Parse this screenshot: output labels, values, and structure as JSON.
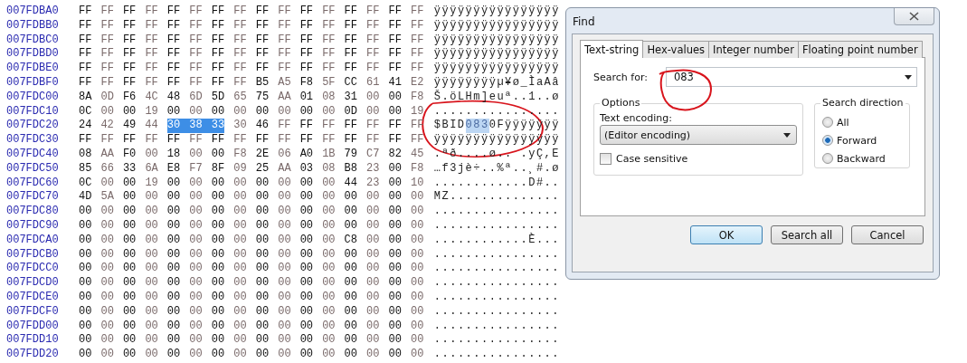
{
  "hex_view": {
    "rows": [
      {
        "address": "007FDBA0",
        "byte_segments": [
          {
            "bytes": "FF FF FF FF FF FF FF FF FF FF FF FF FF FF FF FF",
            "selected": false
          }
        ],
        "text_segments": [
          {
            "text": "ÿÿÿÿÿÿÿÿÿÿÿÿÿÿÿÿ",
            "selected": false
          }
        ]
      },
      {
        "address": "007FDBB0",
        "byte_segments": [
          {
            "bytes": "FF FF FF FF FF FF FF FF FF FF FF FF FF FF FF FF",
            "selected": false
          }
        ],
        "text_segments": [
          {
            "text": "ÿÿÿÿÿÿÿÿÿÿÿÿÿÿÿÿ",
            "selected": false
          }
        ]
      },
      {
        "address": "007FDBC0",
        "byte_segments": [
          {
            "bytes": "FF FF FF FF FF FF FF FF FF FF FF FF FF FF FF FF",
            "selected": false
          }
        ],
        "text_segments": [
          {
            "text": "ÿÿÿÿÿÿÿÿÿÿÿÿÿÿÿÿ",
            "selected": false
          }
        ]
      },
      {
        "address": "007FDBD0",
        "byte_segments": [
          {
            "bytes": "FF FF FF FF FF FF FF FF FF FF FF FF FF FF FF FF",
            "selected": false
          }
        ],
        "text_segments": [
          {
            "text": "ÿÿÿÿÿÿÿÿÿÿÿÿÿÿÿÿ",
            "selected": false
          }
        ]
      },
      {
        "address": "007FDBE0",
        "byte_segments": [
          {
            "bytes": "FF FF FF FF FF FF FF FF FF FF FF FF FF FF FF FF",
            "selected": false
          }
        ],
        "text_segments": [
          {
            "text": "ÿÿÿÿÿÿÿÿÿÿÿÿÿÿÿÿ",
            "selected": false
          }
        ]
      },
      {
        "address": "007FDBF0",
        "byte_segments": [
          {
            "bytes": "FF FF FF FF FF FF FF FF B5 A5 F8 5F CC 61 41 E2",
            "selected": false
          }
        ],
        "text_segments": [
          {
            "text": "ÿÿÿÿÿÿÿÿµ¥ø_ÌaAâ",
            "selected": false
          }
        ]
      },
      {
        "address": "007FDC00",
        "byte_segments": [
          {
            "bytes": "8A 0D F6 4C 48 6D 5D 65 75 AA 01 08 31 00 00 F8",
            "selected": false
          }
        ],
        "text_segments": [
          {
            "text": "Š.öLHm]euª..1..ø",
            "selected": false
          }
        ]
      },
      {
        "address": "007FDC10",
        "byte_segments": [
          {
            "bytes": "0C 00 00 19 00 00 00 00 00 00 00 00 0D 00 00 19",
            "selected": false
          }
        ],
        "text_segments": [
          {
            "text": "................",
            "selected": false
          }
        ]
      },
      {
        "address": "007FDC20",
        "byte_segments": [
          {
            "bytes": "24 42 49 44",
            "selected": false
          },
          {
            "bytes": "30 38 33",
            "selected": true
          },
          {
            "bytes": "30 46 FF FF FF FF FF FF FF",
            "selected": false
          }
        ],
        "text_segments": [
          {
            "text": "$BID",
            "selected": false
          },
          {
            "text": "083",
            "selected": true
          },
          {
            "text": "0Fÿÿÿÿÿÿÿ",
            "selected": false
          }
        ]
      },
      {
        "address": "007FDC30",
        "byte_segments": [
          {
            "bytes": "FF FF FF FF FF FF FF FF FF FF FF FF FF FF FF FF",
            "selected": false
          }
        ],
        "text_segments": [
          {
            "text": "ÿÿÿÿÿÿÿÿÿÿÿÿÿÿÿÿ",
            "selected": false
          }
        ]
      },
      {
        "address": "007FDC40",
        "byte_segments": [
          {
            "bytes": "08 AA F0 00 18 00 00 F8 2E 06 A0 1B 79 C7 82 45",
            "selected": false
          }
        ],
        "text_segments": [
          {
            "text": ".ªð....ø.. .yÇ,E",
            "selected": false
          }
        ]
      },
      {
        "address": "007FDC50",
        "byte_segments": [
          {
            "bytes": "85 66 33 6A E8 F7 8F 09 25 AA 03 08 B8 23 00 F8",
            "selected": false
          }
        ],
        "text_segments": [
          {
            "text": "…f3jè÷..%ª..¸#.ø",
            "selected": false
          }
        ]
      },
      {
        "address": "007FDC60",
        "byte_segments": [
          {
            "bytes": "0C 00 00 19 00 00 00 00 00 00 00 00 44 23 00 10",
            "selected": false
          }
        ],
        "text_segments": [
          {
            "text": "............D#..",
            "selected": false
          }
        ]
      },
      {
        "address": "007FDC70",
        "byte_segments": [
          {
            "bytes": "4D 5A 00 00 00 00 00 00 00 00 00 00 00 00 00 00",
            "selected": false
          }
        ],
        "text_segments": [
          {
            "text": "MZ..............",
            "selected": false
          }
        ]
      },
      {
        "address": "007FDC80",
        "byte_segments": [
          {
            "bytes": "00 00 00 00 00 00 00 00 00 00 00 00 00 00 00 00",
            "selected": false
          }
        ],
        "text_segments": [
          {
            "text": "................",
            "selected": false
          }
        ]
      },
      {
        "address": "007FDC90",
        "byte_segments": [
          {
            "bytes": "00 00 00 00 00 00 00 00 00 00 00 00 00 00 00 00",
            "selected": false
          }
        ],
        "text_segments": [
          {
            "text": "................",
            "selected": false
          }
        ]
      },
      {
        "address": "007FDCA0",
        "byte_segments": [
          {
            "bytes": "00 00 00 00 00 00 00 00 00 00 00 00 C8 00 00 00",
            "selected": false
          }
        ],
        "text_segments": [
          {
            "text": "............È...",
            "selected": false
          }
        ]
      },
      {
        "address": "007FDCB0",
        "byte_segments": [
          {
            "bytes": "00 00 00 00 00 00 00 00 00 00 00 00 00 00 00 00",
            "selected": false
          }
        ],
        "text_segments": [
          {
            "text": "................",
            "selected": false
          }
        ]
      },
      {
        "address": "007FDCC0",
        "byte_segments": [
          {
            "bytes": "00 00 00 00 00 00 00 00 00 00 00 00 00 00 00 00",
            "selected": false
          }
        ],
        "text_segments": [
          {
            "text": "................",
            "selected": false
          }
        ]
      },
      {
        "address": "007FDCD0",
        "byte_segments": [
          {
            "bytes": "00 00 00 00 00 00 00 00 00 00 00 00 00 00 00 00",
            "selected": false
          }
        ],
        "text_segments": [
          {
            "text": "................",
            "selected": false
          }
        ]
      },
      {
        "address": "007FDCE0",
        "byte_segments": [
          {
            "bytes": "00 00 00 00 00 00 00 00 00 00 00 00 00 00 00 00",
            "selected": false
          }
        ],
        "text_segments": [
          {
            "text": "................",
            "selected": false
          }
        ]
      },
      {
        "address": "007FDCF0",
        "byte_segments": [
          {
            "bytes": "00 00 00 00 00 00 00 00 00 00 00 00 00 00 00 00",
            "selected": false
          }
        ],
        "text_segments": [
          {
            "text": "................",
            "selected": false
          }
        ]
      },
      {
        "address": "007FDD00",
        "byte_segments": [
          {
            "bytes": "00 00 00 00 00 00 00 00 00 00 00 00 00 00 00 00",
            "selected": false
          }
        ],
        "text_segments": [
          {
            "text": "................",
            "selected": false
          }
        ]
      },
      {
        "address": "007FDD10",
        "byte_segments": [
          {
            "bytes": "00 00 00 00 00 00 00 00 00 00 00 00 00 00 00 00",
            "selected": false
          }
        ],
        "text_segments": [
          {
            "text": "................",
            "selected": false
          }
        ]
      },
      {
        "address": "007FDD20",
        "byte_segments": [
          {
            "bytes": "00 00 00 00 00 00 00 00 00 00 00 00 00 00 00 00",
            "selected": false
          }
        ],
        "text_segments": [
          {
            "text": "................",
            "selected": false
          }
        ]
      }
    ]
  },
  "find_dialog": {
    "title": "Find",
    "tabs": [
      {
        "label": "Text-string",
        "selected": true
      },
      {
        "label": "Hex-values",
        "selected": false
      },
      {
        "label": "Integer number",
        "selected": false
      },
      {
        "label": "Floating point number",
        "selected": false
      }
    ],
    "search_for": {
      "label": "Search for:",
      "value": "083"
    },
    "options": {
      "title": "Options",
      "encoding_label": "Text encoding:",
      "encoding_value": "(Editor encoding)",
      "case_sensitive": {
        "label": "Case sensitive",
        "checked": false
      }
    },
    "direction": {
      "title": "Search direction",
      "choices": [
        {
          "label": "All",
          "selected": false
        },
        {
          "label": "Forward",
          "selected": true
        },
        {
          "label": "Backward",
          "selected": false
        }
      ]
    },
    "buttons": [
      {
        "label": "OK",
        "default": true
      },
      {
        "label": "Search all",
        "default": false
      },
      {
        "label": "Cancel",
        "default": false
      }
    ]
  }
}
